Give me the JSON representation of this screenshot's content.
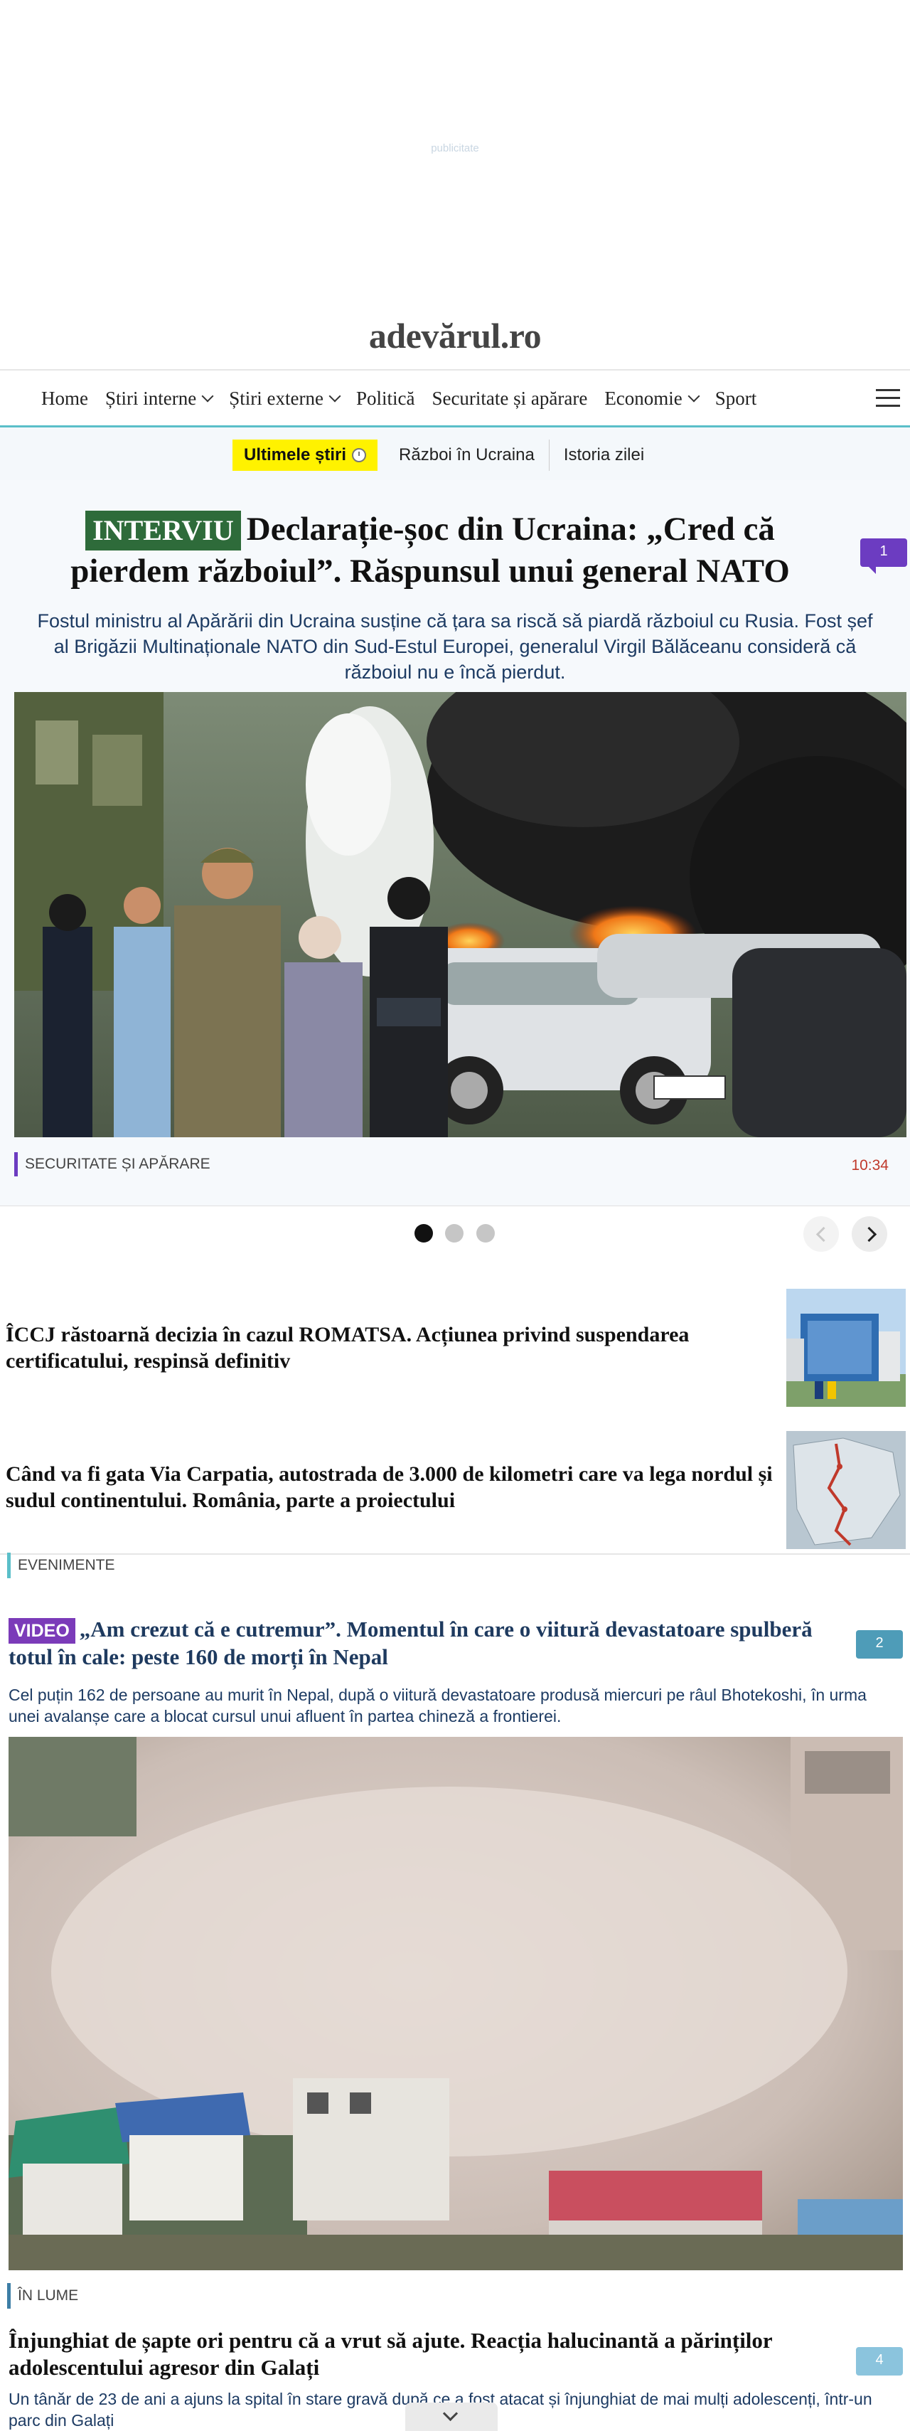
{
  "ad": {
    "label": "publicitate"
  },
  "site": {
    "logo": "adevărul.ro"
  },
  "nav": {
    "items": [
      {
        "label": "Home",
        "dropdown": false
      },
      {
        "label": "Știri interne",
        "dropdown": true
      },
      {
        "label": "Știri externe",
        "dropdown": true
      },
      {
        "label": "Politică",
        "dropdown": false
      },
      {
        "label": "Securitate și apărare",
        "dropdown": false
      },
      {
        "label": "Economie",
        "dropdown": true
      },
      {
        "label": "Sport",
        "dropdown": false
      }
    ]
  },
  "subnav": {
    "live_label": "Ultimele știri",
    "links": [
      "Război în Ucraina",
      "Istoria zilei"
    ]
  },
  "hero": {
    "tag": "INTERVIU",
    "title": "Declarație-șoc din Ucraina: „Cred că pierdem războiul”. Răspunsul unui general NATO",
    "comments": "1",
    "lead": "Fostul ministru al Apărării din Ucraina susține că țara sa riscă să piardă războiul cu Rusia. Fost șef al Brigăzii Multinaționale NATO din Sud-Estul Europei, generalul Virgil Bălăceanu consideră că războiul nu e încă pierdut.",
    "category": "SECURITATE ȘI APĂRARE",
    "time": "10:34"
  },
  "news": [
    {
      "title": "ÎCCJ răstoarnă decizia în cazul ROMATSA. Acțiunea privind suspendarea certificatului, respinsă definitiv"
    },
    {
      "title": "Când va fi gata Via Carpatia, autostrada de 3.000 de kilometri care va lega nordul și sudul continentului. România, parte a proiectului"
    }
  ],
  "article1": {
    "category": "EVENIMENTE",
    "tag": "VIDEO",
    "title": "„Am crezut că e cutremur”. Momentul în care o viitură devastatoare spulberă totul în cale: peste 160 de morți în Nepal",
    "comments": "2",
    "lead": "Cel puțin 162 de persoane au murit în Nepal, după o viitură devastatoare produsă miercuri pe râul Bhotekoshi, în urma unei avalanșe care a blocat cursul unui afluent în partea chineză a frontierei."
  },
  "article2": {
    "category": "ÎN LUME",
    "title": "Înjunghiat de șapte ori pentru că a vrut să ajute. Reacția halucinantă a părinților adolescentului agresor din Galați",
    "comments": "4",
    "lead": "Un tânăr de 23 de ani a ajuns la spital în stare gravă după ce a fost atacat și înjunghiat de mai mulți adolescenți, într-un parc din Galați"
  },
  "colors": {
    "accent_teal": "#5bbfc9",
    "interviu_green": "#2e6b3a",
    "video_purple": "#7b3bb9",
    "live_yellow": "#fff200",
    "time_red": "#c0392b"
  }
}
